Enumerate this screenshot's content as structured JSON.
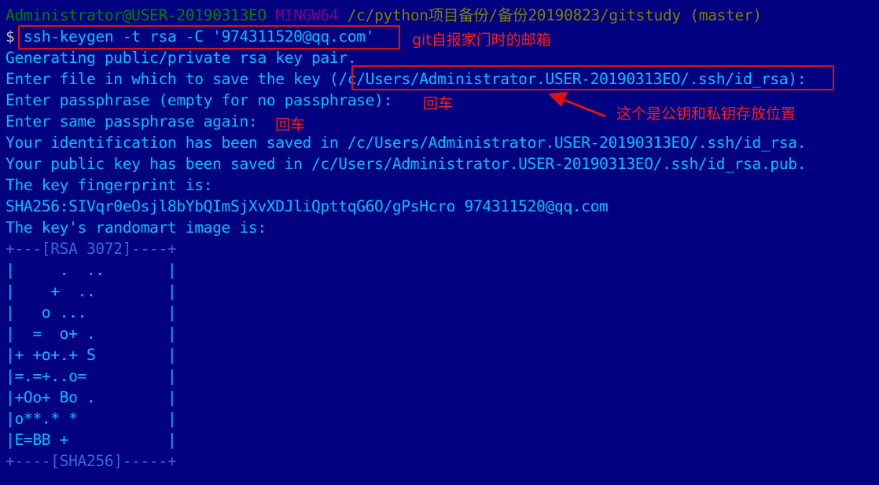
{
  "prompt": {
    "user_host": "Administrator@USER-20190313EO",
    "shell": "MINGW64",
    "path": "/c/python项目备份/备份20190823/gitstudy",
    "branch": "(master)",
    "symbol": "$"
  },
  "command": "ssh-keygen -t rsa -C '974311520@qq.com'",
  "output": {
    "line1": "Generating public/private rsa key pair.",
    "line2_prefix": "Enter file in which to save the key (",
    "line2_path": "/c/Users/Administrator.USER-20190313EO/.ssh/id_rsa",
    "line2_suffix": "):",
    "line3": "Enter passphrase (empty for no passphrase):",
    "line4": "Enter same passphrase again:",
    "line5": "Your identification has been saved in /c/Users/Administrator.USER-20190313EO/.ssh/id_rsa.",
    "line6": "Your public key has been saved in /c/Users/Administrator.USER-20190313EO/.ssh/id_rsa.pub.",
    "line7": "The key fingerprint is:",
    "line8": "SHA256:SIVqr0eOsjl8bYbQImSjXvXDJliQpttqG6O/gPsHcro 974311520@qq.com",
    "line9": "The key's randomart image is:"
  },
  "randomart": {
    "top": "+---[RSA 3072]----+",
    "rows": [
      "|     .  ..       |",
      "|    +  ..        |",
      "|   o ...         |",
      "|  =  o+ .        |",
      "|+ +o+.+ S        |",
      "|=.=+..o=         |",
      "|+Oo+ Bo .        |",
      "|o**.* *          |",
      "|E=BB +           |"
    ],
    "bottom": "+----[SHA256]-----+"
  },
  "annotations": {
    "email_note": "git自报家门时的邮箱",
    "enter1": "回车",
    "enter2": "回车",
    "key_location_note": "这个是公钥和私钥存放位置"
  },
  "colors": {
    "background": "#000080",
    "text": "#00c0ff",
    "annotation": "#ff1a1a"
  }
}
